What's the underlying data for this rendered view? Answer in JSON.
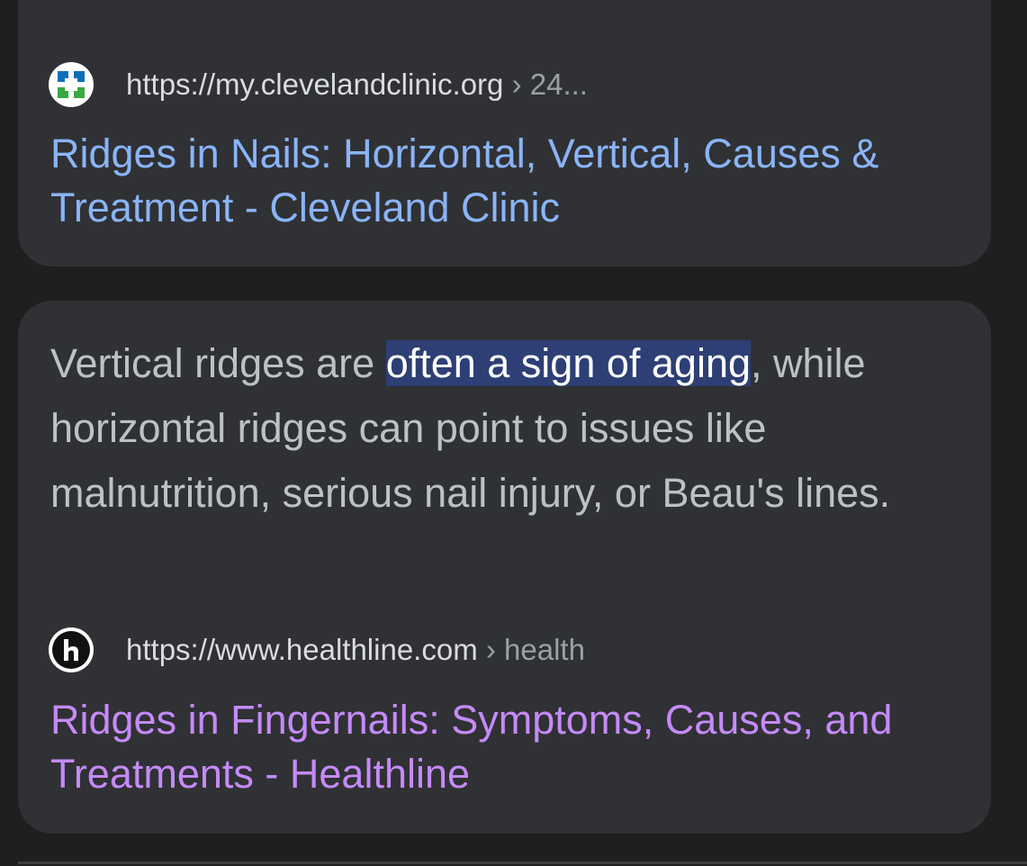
{
  "results": [
    {
      "url_base": "https://my.clevelandclinic.org",
      "url_path": " › 24...",
      "title": "Ridges in Nails: Horizontal, Vertical, Causes & Treatment - Cleveland Clinic",
      "favicon_icon": "cleveland-clinic-logo-icon",
      "link_state": "unvisited"
    },
    {
      "snippet_before": "Vertical ridges are ",
      "snippet_highlight": "often a sign of aging",
      "snippet_after": ", while horizontal ridges can point to issues like malnutrition, serious nail injury, or Beau's lines.",
      "url_base": "https://www.healthline.com",
      "url_path": " › health",
      "title": "Ridges in Fingernails: Symptoms, Causes, and Treatments - Healthline",
      "favicon_icon": "healthline-logo-icon",
      "link_state": "visited"
    }
  ],
  "colors": {
    "background": "#1f1f1f",
    "card": "#303134",
    "link_unvisited": "#8ab4f8",
    "link_visited": "#c58af9",
    "highlight": "#2d3f74"
  }
}
